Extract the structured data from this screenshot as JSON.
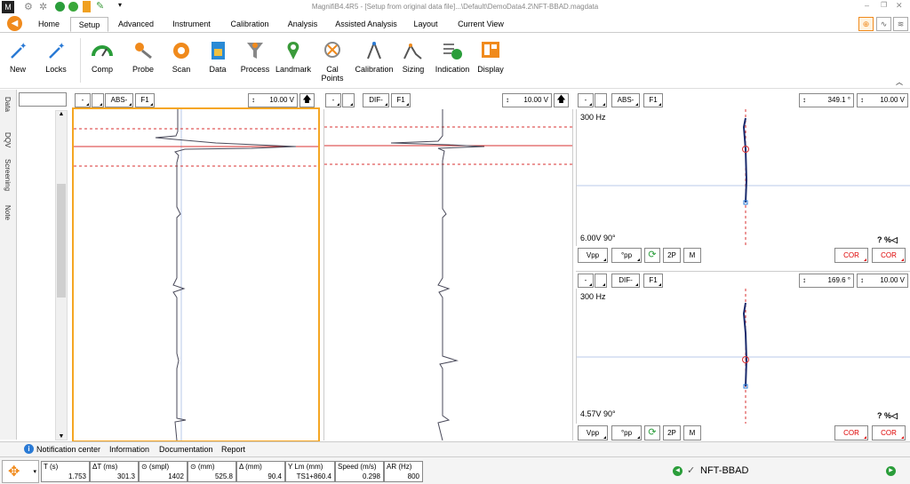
{
  "window": {
    "title": "MagnifiB4.4R5 - [Setup from original data file]...\\Default\\DemoData4.2\\NFT-BBAD.magdata"
  },
  "ribbon_tabs": [
    "Home",
    "Setup",
    "Advanced",
    "Instrument",
    "Calibration",
    "Analysis",
    "Assisted Analysis",
    "Layout",
    "Current View"
  ],
  "ribbon_buttons": [
    "New",
    "Locks",
    "Comp",
    "Probe",
    "Scan",
    "Data",
    "Process",
    "Landmark",
    "Cal\nPoints",
    "Calibration",
    "Sizing",
    "Indication",
    "Display"
  ],
  "ribbon_buttons_cal": {
    "line1": "Cal",
    "line2": "Points"
  },
  "side_tabs": [
    "Data",
    "DQV",
    "Screening",
    "Note"
  ],
  "strip1": {
    "dash": "-",
    "mode": "ABS-",
    "filter": "F1",
    "span": "10.00 V"
  },
  "strip2": {
    "dash": "-",
    "mode": "DIF-",
    "filter": "F1",
    "span": "10.00 V"
  },
  "lissa1": {
    "dash": "-",
    "mode": "ABS-",
    "filter": "F1",
    "rotation": "349.1 °",
    "span": "10.00 V",
    "freq": "300 Hz",
    "scale": "6.00V 90°",
    "qpct": "? %◁"
  },
  "lissa2": {
    "dash": "-",
    "mode": "DIF-",
    "filter": "F1",
    "rotation": "169.6 °",
    "span": "10.00 V",
    "freq": "300 Hz",
    "scale": "4.57V 90°",
    "qpct": "? %◁"
  },
  "lissa_buttons": {
    "vpp": "Vpp",
    "pp": "°pp",
    "twop": "2P",
    "m": "M",
    "cor1": "COR",
    "cor2": "COR"
  },
  "status_links": [
    "Notification center",
    "Information",
    "Documentation",
    "Report"
  ],
  "stats": [
    {
      "h": "T (s)",
      "v": "1.753"
    },
    {
      "h": "ΔT (ms)",
      "v": "301.3"
    },
    {
      "h": "⊙ (smpl)",
      "v": "1402"
    },
    {
      "h": "⊙ (mm)",
      "v": "525.8"
    },
    {
      "h": "Δ (mm)",
      "v": "90.4"
    },
    {
      "h": "Y Lm (mm)",
      "v": "TS1+860.4"
    },
    {
      "h": "Speed (m/s)",
      "v": "0.298"
    },
    {
      "h": "AR (Hz)",
      "v": "800"
    }
  ],
  "file_label": "NFT-BBAD",
  "colors": {
    "accent": "#f5a623",
    "signal": "#1a2a6c",
    "trace": "#4a4a5a",
    "ref": "#d93030",
    "grid": "#b8c8e8",
    "orange_btn": "#f08a1c"
  }
}
